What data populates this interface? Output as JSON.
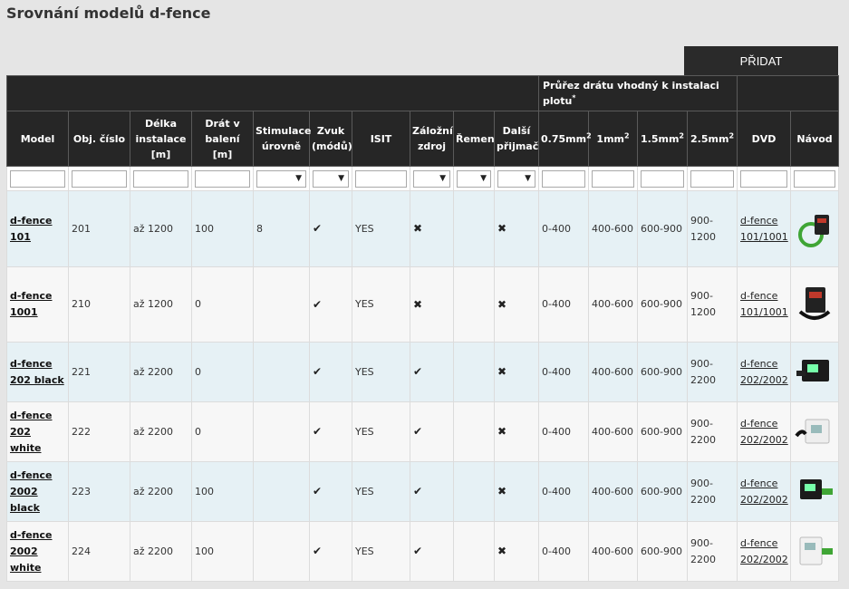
{
  "page": {
    "title": "Srovnání modelů d-fence"
  },
  "toolbar": {
    "add_label": "PŘIDAT"
  },
  "table": {
    "group_header": {
      "label": "Průřez drátu vhodný k instalaci plotu",
      "note": "*"
    },
    "columns": [
      "Model",
      "Obj. číslo",
      "Délka instalace [m]",
      "Drát v balení [m]",
      "Stimulace úrovně",
      "Zvuk (módů)",
      "ISIT",
      "Záložní zdroj",
      "Řemen",
      "Další přijmač",
      "0.75mm",
      "1mm",
      "1.5mm",
      "2.5mm",
      "DVD",
      "Návod"
    ],
    "superscript": "2",
    "rows": [
      {
        "model_a": "d-fence",
        "model_b": "101",
        "obj": "201",
        "delka": "až 1200",
        "drat": "100",
        "stim": "8",
        "zvuk": "check",
        "isit": "YES",
        "zaloz": "cross",
        "remen": "",
        "dalsi": "cross",
        "w075": "0-400",
        "w1": "400-600",
        "w15": "600-900",
        "w25_a": "900-",
        "w25_b": "1200",
        "dvd_a": "d-fence",
        "dvd_b": "101/1001"
      },
      {
        "model_a": "d-fence",
        "model_b": "1001",
        "obj": "210",
        "delka": "až 1200",
        "drat": "0",
        "stim": "",
        "zvuk": "check",
        "isit": "YES",
        "zaloz": "cross",
        "remen": "",
        "dalsi": "cross",
        "w075": "0-400",
        "w1": "400-600",
        "w15": "600-900",
        "w25_a": "900-",
        "w25_b": "1200",
        "dvd_a": "d-fence",
        "dvd_b": "101/1001"
      },
      {
        "model_a": "d-fence",
        "model_b": "202 black",
        "obj": "221",
        "delka": "až 2200",
        "drat": "0",
        "stim": "",
        "zvuk": "check",
        "isit": "YES",
        "zaloz": "check",
        "remen": "",
        "dalsi": "cross",
        "w075": "0-400",
        "w1": "400-600",
        "w15": "600-900",
        "w25_a": "900-",
        "w25_b": "2200",
        "dvd_a": "d-fence",
        "dvd_b": "202/2002"
      },
      {
        "model_a": "d-fence",
        "model_b": "202 white",
        "obj": "222",
        "delka": "až 2200",
        "drat": "0",
        "stim": "",
        "zvuk": "check",
        "isit": "YES",
        "zaloz": "check",
        "remen": "",
        "dalsi": "cross",
        "w075": "0-400",
        "w1": "400-600",
        "w15": "600-900",
        "w25_a": "900-",
        "w25_b": "2200",
        "dvd_a": "d-fence",
        "dvd_b": "202/2002"
      },
      {
        "model_a": "d-fence",
        "model_b": "2002 black",
        "obj": "223",
        "delka": "až 2200",
        "drat": "100",
        "stim": "",
        "zvuk": "check",
        "isit": "YES",
        "zaloz": "check",
        "remen": "",
        "dalsi": "cross",
        "w075": "0-400",
        "w1": "400-600",
        "w15": "600-900",
        "w25_a": "900-",
        "w25_b": "2200",
        "dvd_a": "d-fence",
        "dvd_b": "202/2002"
      },
      {
        "model_a": "d-fence",
        "model_b": "2002 white",
        "obj": "224",
        "delka": "až 2200",
        "drat": "100",
        "stim": "",
        "zvuk": "check",
        "isit": "YES",
        "zaloz": "check",
        "remen": "",
        "dalsi": "cross",
        "w075": "0-400",
        "w1": "400-600",
        "w15": "600-900",
        "w25_a": "900-",
        "w25_b": "2200",
        "dvd_a": "d-fence",
        "dvd_b": "202/2002"
      }
    ]
  }
}
